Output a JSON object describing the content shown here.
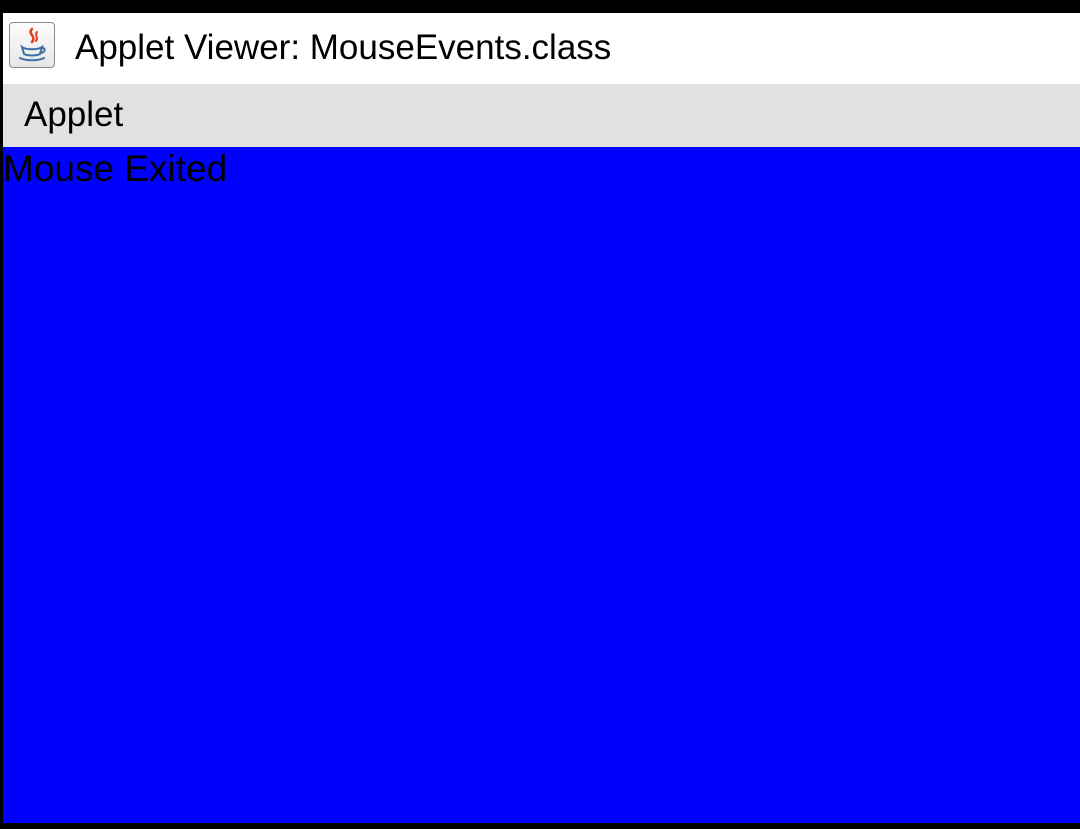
{
  "window": {
    "title": "Applet Viewer: MouseEvents.class",
    "icon": "java-cup-icon"
  },
  "menubar": {
    "items": [
      {
        "label": "Applet"
      }
    ]
  },
  "applet": {
    "background_color": "#0000ff",
    "message": "Mouse Exited"
  }
}
